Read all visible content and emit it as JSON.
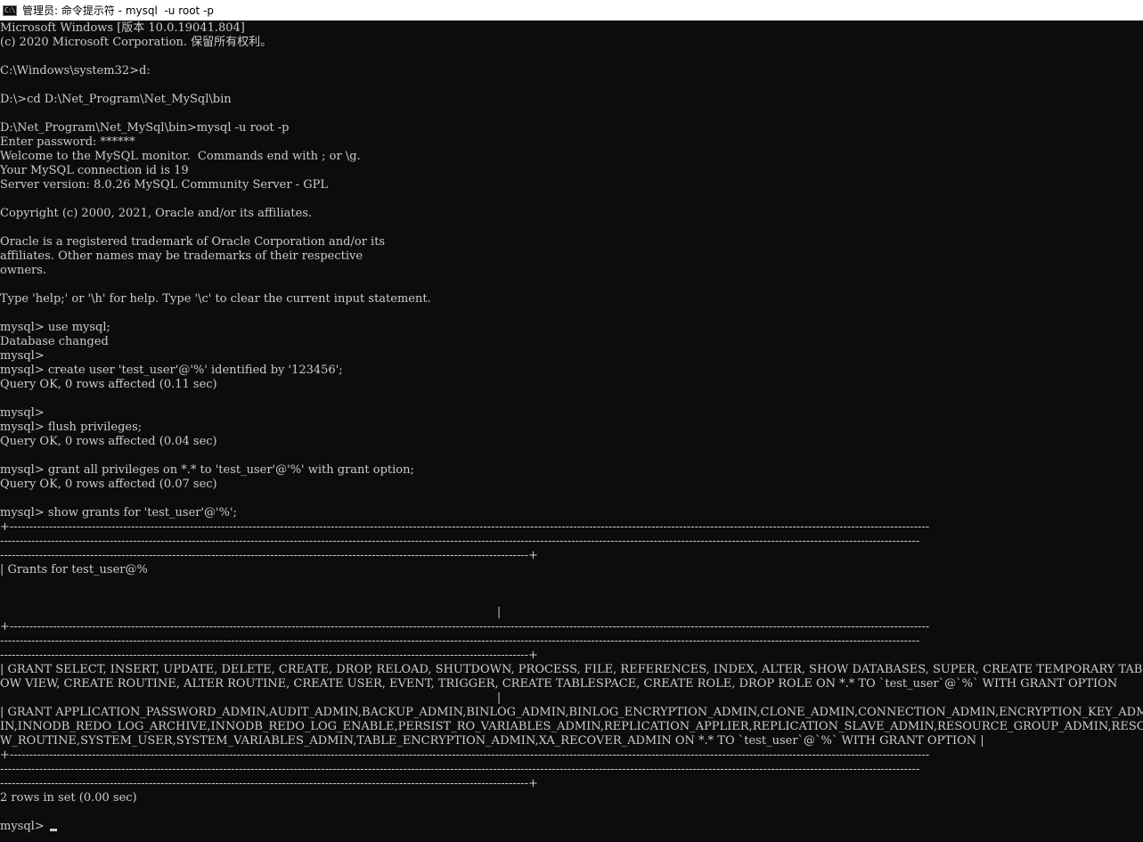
{
  "window": {
    "title": "管理员: 命令提示符 - mysql  -u root -p",
    "icon": "console-icon",
    "icon_glyph": "C:\\",
    "background": "#0c0c0c",
    "foreground": "#cccccc"
  },
  "console": {
    "lines": [
      "Microsoft Windows [版本 10.0.19041.804]",
      "(c) 2020 Microsoft Corporation. 保留所有权利。",
      "",
      "C:\\Windows\\system32>d:",
      "",
      "D:\\>cd D:\\Net_Program\\Net_MySql\\bin",
      "",
      "D:\\Net_Program\\Net_MySql\\bin>mysql -u root -p",
      "Enter password: ******",
      "Welcome to the MySQL monitor.  Commands end with ; or \\g.",
      "Your MySQL connection id is 19",
      "Server version: 8.0.26 MySQL Community Server - GPL",
      "",
      "Copyright (c) 2000, 2021, Oracle and/or its affiliates.",
      "",
      "Oracle is a registered trademark of Oracle Corporation and/or its",
      "affiliates. Other names may be trademarks of their respective",
      "owners.",
      "",
      "Type 'help;' or '\\h' for help. Type '\\c' to clear the current input statement.",
      "",
      "mysql> use mysql;",
      "Database changed",
      "mysql>",
      "mysql> create user 'test_user'@'%' identified by '123456';",
      "Query OK, 0 rows affected (0.11 sec)",
      "",
      "mysql>",
      "mysql> flush privileges;",
      "Query OK, 0 rows affected (0.04 sec)",
      "",
      "mysql> grant all privileges on *.* to 'test_user'@'%' with grant option;",
      "Query OK, 0 rows affected (0.07 sec)",
      "",
      "mysql> show grants for 'test_user'@'%';",
      "+-------------------------------------------------------------------------------------------------------------------------------------------------------------------------------------------------------------------------------------------",
      "-------------------------------------------------------------------------------------------------------------------------------------------------------------------------------------------------------------------------------------------",
      "---------------------------------------------------------------------------------------------------------------------------------------+",
      "| Grants for test_user@%",
      "",
      "",
      "                                                                                                                                       |",
      "+-------------------------------------------------------------------------------------------------------------------------------------------------------------------------------------------------------------------------------------------",
      "-------------------------------------------------------------------------------------------------------------------------------------------------------------------------------------------------------------------------------------------",
      "---------------------------------------------------------------------------------------------------------------------------------------+",
      "| GRANT SELECT, INSERT, UPDATE, DELETE, CREATE, DROP, RELOAD, SHUTDOWN, PROCESS, FILE, REFERENCES, INDEX, ALTER, SHOW DATABASES, SUPER, CREATE TEMPORARY TABLES, LOCK TABLES, EXECUTE, REPLICATION SLAVE, REPLICATION CLIENT, CREATE VIEW, SH",
      "OW VIEW, CREATE ROUTINE, ALTER ROUTINE, CREATE USER, EVENT, TRIGGER, CREATE TABLESPACE, CREATE ROLE, DROP ROLE ON *.* TO `test_user`@`%` WITH GRANT OPTION",
      "                                                                                                                                       |",
      "| GRANT APPLICATION_PASSWORD_ADMIN,AUDIT_ADMIN,BACKUP_ADMIN,BINLOG_ADMIN,BINLOG_ENCRYPTION_ADMIN,CLONE_ADMIN,CONNECTION_ADMIN,ENCRYPTION_KEY_ADMIN,FLUSH_OPTIMIZER_COSTS,FLUSH_STATUS,FLUSH_TABLES,FLUSH_USER_RESOURCES,GROUP_REPLICATION_ADM",
      "IN,INNODB_REDO_LOG_ARCHIVE,INNODB_REDO_LOG_ENABLE,PERSIST_RO_VARIABLES_ADMIN,REPLICATION_APPLIER,REPLICATION_SLAVE_ADMIN,RESOURCE_GROUP_ADMIN,RESOURCE_GROUP_USER,ROLE_ADMIN,SERVICE_CONNECTION_ADMIN,SESSION_VARIABLES_ADMIN,SET_USER_ID,SHO",
      "W_ROUTINE,SYSTEM_USER,SYSTEM_VARIABLES_ADMIN,TABLE_ENCRYPTION_ADMIN,XA_RECOVER_ADMIN ON *.* TO `test_user`@`%` WITH GRANT OPTION |",
      "+-------------------------------------------------------------------------------------------------------------------------------------------------------------------------------------------------------------------------------------------",
      "-------------------------------------------------------------------------------------------------------------------------------------------------------------------------------------------------------------------------------------------",
      "---------------------------------------------------------------------------------------------------------------------------------------+",
      "2 rows in set (0.00 sec)",
      "",
      "mysql> "
    ]
  }
}
